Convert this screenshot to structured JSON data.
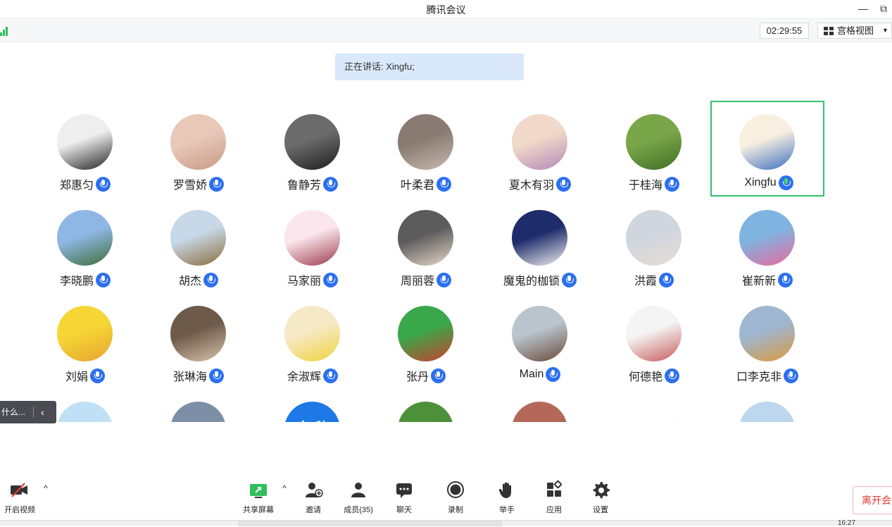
{
  "window": {
    "title": "腾讯会议",
    "minimize": "—",
    "restore": "⧉"
  },
  "topbar": {
    "timer": "02:29:55",
    "view_label": "宫格视图",
    "view_caret": "▼"
  },
  "speaking": {
    "text": "正在讲话: Xingfu;"
  },
  "participants": [
    {
      "name": "郑惠匀",
      "avatar": [
        "#eeeeee",
        "#222222"
      ]
    },
    {
      "name": "罗雪娇",
      "avatar": [
        "#e8c8b8",
        "#c99a86"
      ]
    },
    {
      "name": "鲁静芳",
      "avatar": [
        "#6b6b6b",
        "#1e1e1e"
      ]
    },
    {
      "name": "叶柔君",
      "avatar": [
        "#8a7b72",
        "#c7b9b0"
      ]
    },
    {
      "name": "夏木有羽",
      "avatar": [
        "#f0d9c8",
        "#b58ab8"
      ]
    },
    {
      "name": "于桂海",
      "avatar": [
        "#7aa64a",
        "#3e6f24"
      ]
    },
    {
      "name": "Xingfu",
      "avatar": [
        "#f8efe0",
        "#3a6fc0"
      ],
      "active": true
    },
    {
      "name": "李晓鹏",
      "avatar": [
        "#8fb7e6",
        "#3f6e3a"
      ]
    },
    {
      "name": "胡杰",
      "avatar": [
        "#c7d8e8",
        "#8a6d3b"
      ]
    },
    {
      "name": "马家丽",
      "avatar": [
        "#fbe6ee",
        "#9a3a4a"
      ]
    },
    {
      "name": "周丽蓉",
      "avatar": [
        "#5c5c5c",
        "#e6d8c8"
      ]
    },
    {
      "name": "魔鬼的枷锁",
      "avatar": [
        "#1e2c6b",
        "#f2f2f2"
      ]
    },
    {
      "name": "洪霞",
      "avatar": [
        "#cfd6de",
        "#e8dcd3"
      ]
    },
    {
      "name": "崔新新",
      "avatar": [
        "#7fb4e0",
        "#e86aa0"
      ]
    },
    {
      "name": "刘娟",
      "avatar": [
        "#f5d635",
        "#e8a431"
      ]
    },
    {
      "name": "张琳海",
      "avatar": [
        "#6e5a4a",
        "#d8c3a8"
      ]
    },
    {
      "name": "余淑辉",
      "avatar": [
        "#f6e9c6",
        "#f0d33c"
      ]
    },
    {
      "name": "张丹",
      "avatar": [
        "#38a84a",
        "#c9402d"
      ]
    },
    {
      "name": "Main",
      "avatar": [
        "#b9c4cc",
        "#6a4a3a"
      ]
    },
    {
      "name": "何德艳",
      "avatar": [
        "#f4f4f4",
        "#c85a5a"
      ]
    },
    {
      "name": "口李克非",
      "avatar": [
        "#9fb6d0",
        "#d89a3e"
      ]
    },
    {
      "name": "",
      "avatar": [
        "#bfe0f5",
        "#f5f5f0"
      ]
    },
    {
      "name": "",
      "avatar": [
        "#7c8fa6",
        "#b9a98a"
      ]
    },
    {
      "name": "",
      "avatar": [
        "#1e78e6",
        "#1e78e6"
      ],
      "text": "全欣"
    },
    {
      "name": "",
      "avatar": [
        "#4e8f3a",
        "#2f6a24"
      ]
    },
    {
      "name": "",
      "avatar": [
        "#b5685a",
        "#6e3a33"
      ]
    },
    {
      "name": "",
      "avatar": [
        "#ffffff",
        "#f0e4d8"
      ]
    },
    {
      "name": "",
      "avatar": [
        "#bcd7ee",
        "#d0b58c"
      ]
    }
  ],
  "side_tab": {
    "text": "什么...",
    "arrow": "‹"
  },
  "toolbar": {
    "video": "开启视频",
    "video_caret": "^",
    "share": "共享屏幕",
    "share_caret": "^",
    "invite": "邀请",
    "members": "成员(35)",
    "chat": "聊天",
    "record": "录制",
    "raise_hand": "举手",
    "apps": "应用",
    "settings": "设置",
    "leave": "离开会"
  },
  "taskbar": {
    "time": "16:27"
  },
  "colors": {
    "accent": "#2c6ff0",
    "active_border": "#33c26f",
    "speaking_bg": "#d9e8fb",
    "leave": "#e53935"
  }
}
